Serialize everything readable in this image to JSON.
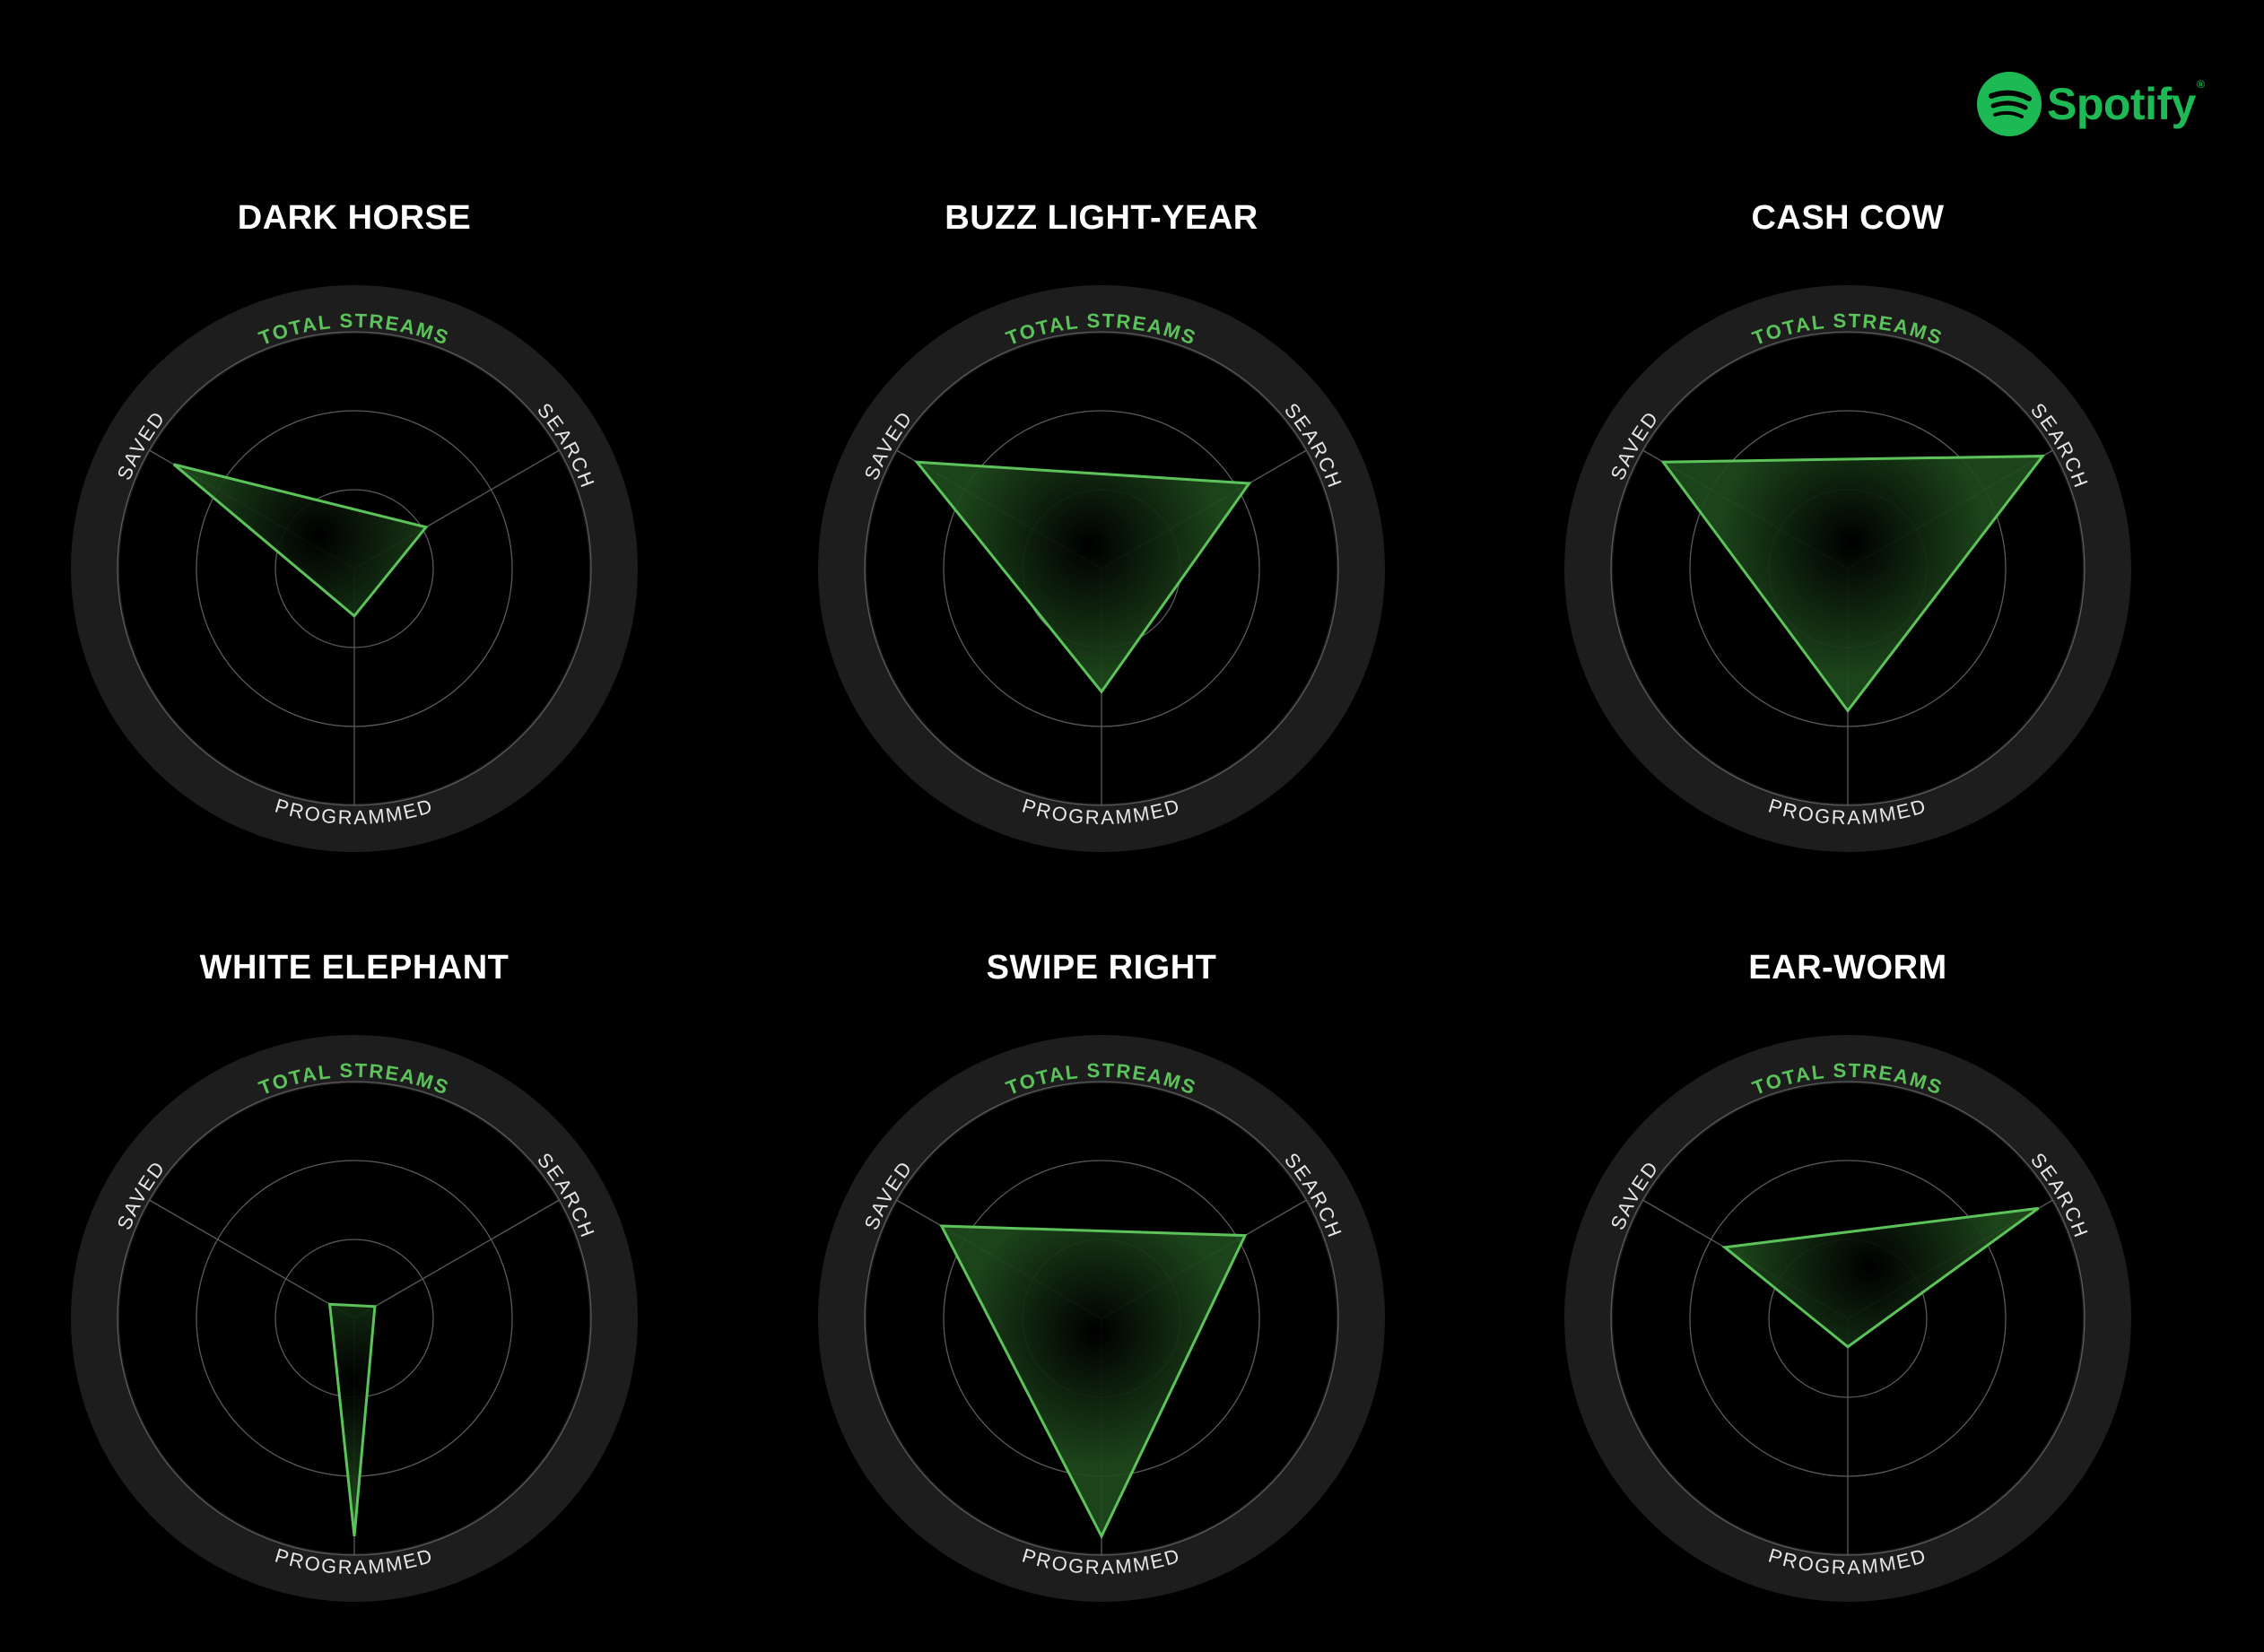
{
  "brand": {
    "name": "Spotify",
    "color": "#1db954",
    "icon": "spotify-logo-icon"
  },
  "colors": {
    "background": "#000000",
    "ring": "#1d1d1d",
    "grid": "#5a5a5a",
    "polygon_stroke": "#5cc25a",
    "accent_label": "#5cc25a",
    "label": "#e6e6e6"
  },
  "chart_data": [
    {
      "type": "radar",
      "title": "DARK HORSE",
      "axes": [
        "TOTAL STREAMS",
        "SEARCH",
        "PROGRAMMED",
        "SAVED"
      ],
      "series": [
        {
          "values": {
            "SEARCH": 0.35,
            "PROGRAMMED": 0.2,
            "SAVED": 0.88
          }
        }
      ],
      "range": [
        0,
        1
      ],
      "grid_rings": 3
    },
    {
      "type": "radar",
      "title": "BUZZ LIGHT-YEAR",
      "axes": [
        "TOTAL STREAMS",
        "SEARCH",
        "PROGRAMMED",
        "SAVED"
      ],
      "series": [
        {
          "values": {
            "SEARCH": 0.72,
            "PROGRAMMED": 0.52,
            "SAVED": 0.9
          }
        }
      ],
      "range": [
        0,
        1
      ],
      "grid_rings": 3
    },
    {
      "type": "radar",
      "title": "CASH COW",
      "axes": [
        "TOTAL STREAMS",
        "SEARCH",
        "PROGRAMMED",
        "SAVED"
      ],
      "series": [
        {
          "values": {
            "SEARCH": 0.95,
            "PROGRAMMED": 0.6,
            "SAVED": 0.9
          }
        }
      ],
      "range": [
        0,
        1
      ],
      "grid_rings": 3
    },
    {
      "type": "radar",
      "title": "WHITE ELEPHANT",
      "axes": [
        "TOTAL STREAMS",
        "SEARCH",
        "PROGRAMMED",
        "SAVED"
      ],
      "series": [
        {
          "values": {
            "SEARCH": 0.1,
            "PROGRAMMED": 0.92,
            "SAVED": 0.12
          }
        }
      ],
      "range": [
        0,
        1
      ],
      "grid_rings": 3
    },
    {
      "type": "radar",
      "title": "SWIPE RIGHT",
      "axes": [
        "TOTAL STREAMS",
        "SEARCH",
        "PROGRAMMED",
        "SAVED"
      ],
      "series": [
        {
          "values": {
            "SEARCH": 0.7,
            "PROGRAMMED": 0.92,
            "SAVED": 0.78
          }
        }
      ],
      "range": [
        0,
        1
      ],
      "grid_rings": 3
    },
    {
      "type": "radar",
      "title": "EAR-WORM",
      "axes": [
        "TOTAL STREAMS",
        "SEARCH",
        "PROGRAMMED",
        "SAVED"
      ],
      "series": [
        {
          "values": {
            "SEARCH": 0.93,
            "PROGRAMMED": 0.12,
            "SAVED": 0.6
          }
        }
      ],
      "range": [
        0,
        1
      ],
      "grid_rings": 3
    }
  ]
}
